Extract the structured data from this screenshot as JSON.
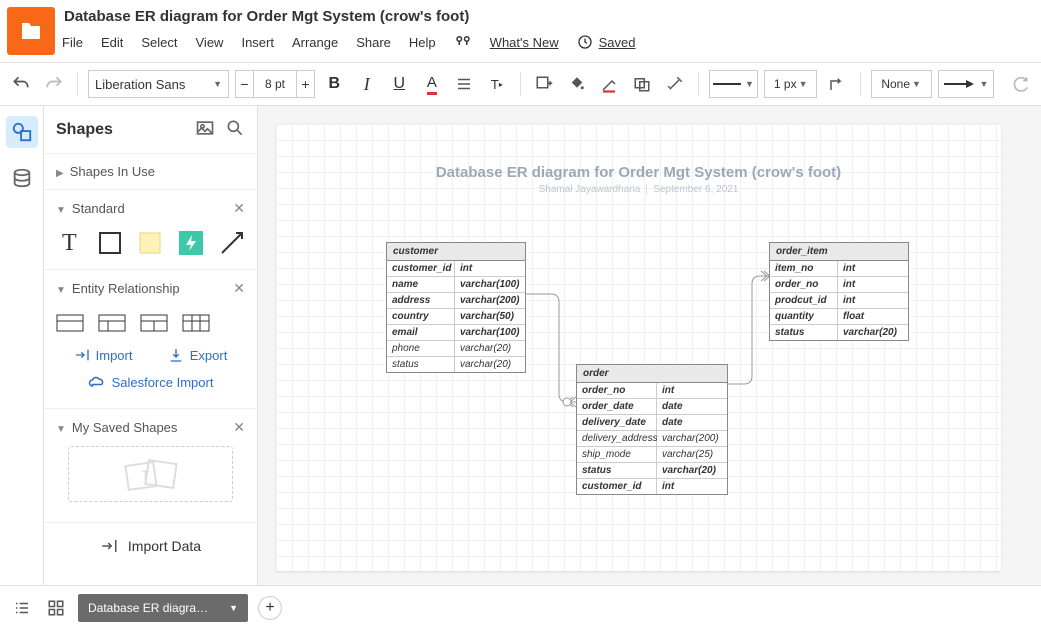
{
  "doc": {
    "title": "Database ER diagram for Order  Mgt System (crow's foot)"
  },
  "menubar": {
    "file": "File",
    "edit": "Edit",
    "select": "Select",
    "view": "View",
    "insert": "Insert",
    "arrange": "Arrange",
    "share": "Share",
    "help": "Help",
    "whatsnew": "What's New",
    "saved": "Saved"
  },
  "toolbar": {
    "font": "Liberation Sans",
    "size": "8 pt",
    "linewidth": "1 px",
    "fill": "None"
  },
  "sidebar": {
    "title": "Shapes",
    "shapes_in_use": "Shapes In Use",
    "standard": "Standard",
    "er": "Entity Relationship",
    "import": "Import",
    "export": "Export",
    "sf": "Salesforce Import",
    "saved": "My Saved Shapes",
    "import_data": "Import Data"
  },
  "canvas": {
    "title": "Database ER diagram for Order  Mgt System (crow's foot)",
    "author": "Shamal Jayawardhana",
    "date": "September 6, 2021"
  },
  "entities": {
    "customer": {
      "name": "customer",
      "rows": [
        {
          "f": "customer_id",
          "t": "int",
          "b": true
        },
        {
          "f": "name",
          "t": "varchar(100)",
          "b": true
        },
        {
          "f": "address",
          "t": "varchar(200)",
          "b": true
        },
        {
          "f": "country",
          "t": "varchar(50)",
          "b": true
        },
        {
          "f": "email",
          "t": "varchar(100)",
          "b": true
        },
        {
          "f": "phone",
          "t": "varchar(20)"
        },
        {
          "f": "status",
          "t": "varchar(20)"
        }
      ]
    },
    "order": {
      "name": "order",
      "rows": [
        {
          "f": "order_no",
          "t": "int",
          "b": true
        },
        {
          "f": "order_date",
          "t": "date",
          "b": true
        },
        {
          "f": "delivery_date",
          "t": "date",
          "b": true
        },
        {
          "f": "delivery_address",
          "t": "varchar(200)"
        },
        {
          "f": "ship_mode",
          "t": "varchar(25)"
        },
        {
          "f": "status",
          "t": "varchar(20)",
          "b": true
        },
        {
          "f": "customer_id",
          "t": "int",
          "b": true
        }
      ]
    },
    "order_item": {
      "name": "order_item",
      "rows": [
        {
          "f": "item_no",
          "t": "int",
          "b": true
        },
        {
          "f": "order_no",
          "t": "int",
          "b": true
        },
        {
          "f": "prodcut_id",
          "t": "int",
          "b": true
        },
        {
          "f": "quantity",
          "t": "float",
          "b": true
        },
        {
          "f": "status",
          "t": "varchar(20)",
          "b": true
        }
      ]
    }
  },
  "footer": {
    "tab": "Database ER diagra…"
  }
}
